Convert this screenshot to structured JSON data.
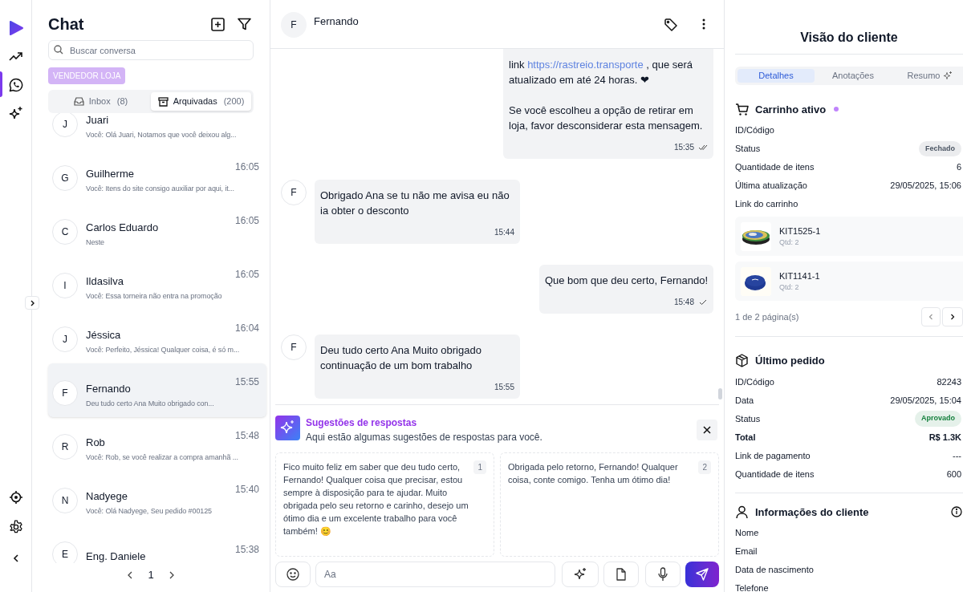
{
  "rail": {
    "top": [
      {
        "kind": "trend",
        "selected": false
      },
      {
        "kind": "whatsapp",
        "selected": true
      },
      {
        "kind": "sparkles",
        "selected": false
      }
    ],
    "bottom": [
      {
        "kind": "target",
        "selected": false
      },
      {
        "kind": "settings",
        "selected": false
      }
    ]
  },
  "chat_list": {
    "title": "Chat",
    "search": {
      "placeholder": "Buscar conversa"
    },
    "tag": "VENDEDOR LOJA",
    "tabs": [
      {
        "label": "Inbox",
        "count": "(8)",
        "selected": false
      },
      {
        "label": "Arquivadas",
        "count": "(200)",
        "selected": true
      }
    ],
    "conversations": [
      {
        "initial": "J",
        "name": "Juari",
        "preview": "Você: Olá Juari, Notamos que você deixou alg...",
        "selected": false
      },
      {
        "initial": "G",
        "name": "Guilherme",
        "time": "16:05",
        "preview": "Você: Itens do site consigo auxiliar por aqui, it...",
        "selected": false
      },
      {
        "initial": "C",
        "name": "Carlos Eduardo",
        "time": "16:05",
        "preview": "Neste",
        "selected": false
      },
      {
        "initial": "I",
        "name": "Ildasilva",
        "time": "16:05",
        "preview": "Você: Essa torneira não entra na promoção",
        "selected": false
      },
      {
        "initial": "J",
        "name": "Jéssica",
        "time": "16:04",
        "preview": "Você: Perfeito, Jéssica! Qualquer coisa, é só m...",
        "selected": false
      },
      {
        "initial": "F",
        "name": "Fernando",
        "time": "15:55",
        "preview": "Deu tudo certo Ana Muito obrigado con...",
        "selected": true
      },
      {
        "initial": "R",
        "name": "Rob",
        "time": "15:48",
        "preview": "Você: Rob, se você realizar a compra amanhã ...",
        "selected": false
      },
      {
        "initial": "N",
        "name": "Nadyege",
        "time": "15:40",
        "preview": "Você: Olá Nadyege, Seu pedido #00125",
        "selected": false
      },
      {
        "initial": "E",
        "name": "Eng. Daniele",
        "time": "15:38",
        "selected": false
      }
    ],
    "pagination": {
      "page": "1"
    }
  },
  "conversation": {
    "contact": {
      "initial": "F",
      "name": "Fernando"
    },
    "messages": [
      {
        "kind": "outgoing",
        "paragraphs": [
          [
            {
              "text": "link "
            },
            {
              "text": "https://rastreio.transporte",
              "link": true
            },
            {
              "text": " , que será atualizado em até 24 horas. ❤"
            }
          ],
          [
            {
              "text": "Se você escolheu a opção de retirar em loja, favor desconsiderar esta mensagem."
            }
          ]
        ],
        "time": "15:35",
        "read": true
      },
      {
        "kind": "incoming",
        "initial": "F",
        "paragraphs": [
          [
            {
              "text": "Obrigado Ana se tu não me avisa eu não ia obter o desconto"
            }
          ]
        ],
        "time": "15:44"
      },
      {
        "kind": "outgoing",
        "paragraphs": [
          [
            {
              "text": "Que bom que deu certo, Fernando!"
            }
          ]
        ],
        "time": "15:48",
        "read": false
      },
      {
        "kind": "incoming",
        "initial": "F",
        "paragraphs": [
          [
            {
              "text": "Deu tudo certo Ana Muito obrigado continuação de um bom trabalho"
            }
          ]
        ],
        "time": "15:55"
      }
    ],
    "suggestions": {
      "title": "Sugestões de respostas",
      "subtitle": "Aqui estão algumas sugestões de respostas para você.",
      "items": [
        {
          "number": "1",
          "text": "Fico muito feliz em saber que deu tudo certo, Fernando! Qualquer coisa que precisar, estou sempre à disposição para te ajudar. Muito obrigada pelo seu retorno e carinho, desejo um ótimo dia e um excelente trabalho para você também! 😊"
        },
        {
          "number": "2",
          "text": "Obrigada pelo retorno, Fernando! Qualquer coisa, conte comigo. Tenha um ótimo dia!"
        }
      ]
    },
    "composer": {
      "placeholder": "Aa"
    }
  },
  "customer": {
    "title": "Visão do cliente",
    "tabs": [
      {
        "label": "Detalhes",
        "selected": true
      },
      {
        "label": "Anotações",
        "selected": false
      },
      {
        "label": "Resumo",
        "selected": false
      }
    ],
    "cart": {
      "title": "Carrinho ativo",
      "color": "#c084fc",
      "rows": [
        {
          "label": "ID/Código",
          "kind": "text"
        },
        {
          "label": "Status",
          "value": "Fechado",
          "kind": "badge",
          "color": "#4b5563"
        },
        {
          "label": "Quantidade de itens",
          "value": "6",
          "kind": "text"
        },
        {
          "label": "Última atualização",
          "value": "29/05/2025, 15:06",
          "kind": "text"
        },
        {
          "label": "Link do carrinho",
          "kind": "text"
        }
      ],
      "items": [
        {
          "code": "KIT1525-1",
          "qty": "Qtd: 2",
          "kind": "picture"
        },
        {
          "code": "KIT1141-1",
          "qty": "Qtd: 2",
          "kind": "picture"
        }
      ],
      "pages": "1 de 2 página(s)"
    },
    "order": {
      "title": "Último pedido",
      "rows": [
        {
          "label": "ID/Código",
          "value": "82243",
          "kind": "text"
        },
        {
          "label": "Data",
          "value": "29/05/2025, 15:04",
          "kind": "text"
        },
        {
          "label": "Status",
          "value": "Aprovado",
          "kind": "badge",
          "color": "#15803d"
        },
        {
          "label": "Total",
          "value": "R$ 1.3K",
          "kind": "bold"
        },
        {
          "label": "Link de pagamento",
          "value": "---",
          "kind": "text"
        },
        {
          "label": "Quantidade de itens",
          "value": "600",
          "kind": "text"
        }
      ]
    },
    "client": {
      "title": "Informações do cliente",
      "rows": [
        {
          "label": "Nome",
          "kind": "text"
        },
        {
          "label": "Email",
          "kind": "text"
        },
        {
          "label": "Data de nascimento",
          "kind": "text"
        },
        {
          "label": "Telefone",
          "kind": "text"
        }
      ]
    }
  }
}
